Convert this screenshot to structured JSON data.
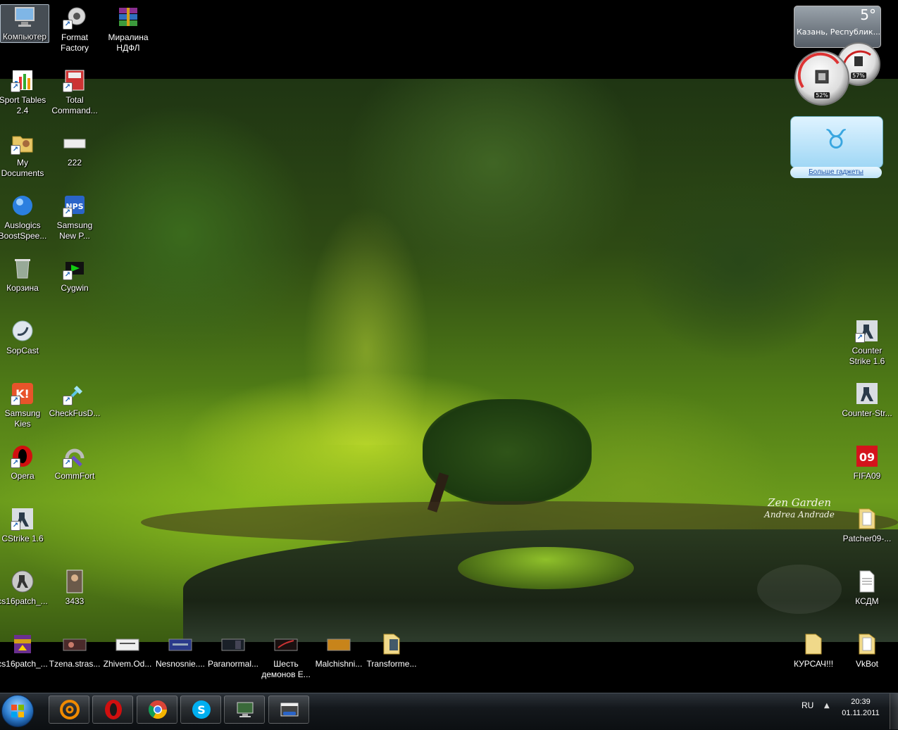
{
  "wallpaper": {
    "title": "Zen Garden",
    "author": "Andrea Andrade"
  },
  "desktop_icons": [
    {
      "id": "computer",
      "label": "Компьютер",
      "icon": "computer-icon"
    },
    {
      "id": "format-factory",
      "label": "Format Factory",
      "icon": "format-factory-icon"
    },
    {
      "id": "miralina",
      "label": "Миралина НДФЛ",
      "icon": "winrar-archive-icon"
    },
    {
      "id": "sport-tables",
      "label": "Sport Tables 2.4",
      "icon": "sport-tables-icon"
    },
    {
      "id": "total-commander",
      "label": "Total Command...",
      "icon": "total-commander-icon"
    },
    {
      "id": "my-documents",
      "label": "My Documents",
      "icon": "documents-folder-icon"
    },
    {
      "id": "file-222",
      "label": "222",
      "icon": "image-file-icon"
    },
    {
      "id": "auslogics",
      "label": "Auslogics BoostSpee...",
      "icon": "auslogics-icon"
    },
    {
      "id": "samsung-nps",
      "label": "Samsung New P...",
      "icon": "nps-icon"
    },
    {
      "id": "recycle-bin",
      "label": "Корзина",
      "icon": "recycle-bin-icon"
    },
    {
      "id": "cygwin",
      "label": "Cygwin",
      "icon": "cygwin-icon"
    },
    {
      "id": "sopcast",
      "label": "SopCast",
      "icon": "sopcast-icon"
    },
    {
      "id": "samsung-kies",
      "label": "Samsung Kies",
      "icon": "kies-icon"
    },
    {
      "id": "checkfusd",
      "label": "CheckFusD...",
      "icon": "checkfusd-icon"
    },
    {
      "id": "opera",
      "label": "Opera",
      "icon": "opera-icon"
    },
    {
      "id": "commfort",
      "label": "CommFort",
      "icon": "commfort-icon"
    },
    {
      "id": "cstrike",
      "label": "CStrike 1.6",
      "icon": "counter-strike-icon"
    },
    {
      "id": "cs16patch1",
      "label": "cs16patch_...",
      "icon": "cs-patch-icon"
    },
    {
      "id": "file-3433",
      "label": "3433",
      "icon": "image-file-icon"
    },
    {
      "id": "cs16patch2",
      "label": "cs16patch_...",
      "icon": "installer-icon"
    },
    {
      "id": "tzena",
      "label": "Tzena.stras...",
      "icon": "video-thumb-icon"
    },
    {
      "id": "zhivem",
      "label": "Zhivem.Od...",
      "icon": "video-thumb-icon"
    },
    {
      "id": "nesnosnie",
      "label": "Nesnosnie....",
      "icon": "video-thumb-icon"
    },
    {
      "id": "paranormal",
      "label": "Paranormal...",
      "icon": "video-thumb-icon"
    },
    {
      "id": "shest",
      "label": "Шесть демонов Е...",
      "icon": "video-thumb-icon"
    },
    {
      "id": "malchishni",
      "label": "Malchishni...",
      "icon": "video-thumb-icon"
    },
    {
      "id": "transforme",
      "label": "Transforme...",
      "icon": "folder-icon"
    },
    {
      "id": "counter-strike-16",
      "label": "Counter Strike 1.6",
      "icon": "counter-strike-icon"
    },
    {
      "id": "counter-str",
      "label": "Counter-Str...",
      "icon": "counter-strike-icon"
    },
    {
      "id": "fifa09",
      "label": "FIFA09",
      "icon": "fifa09-icon"
    },
    {
      "id": "patcher09",
      "label": "Patcher09-...",
      "icon": "folder-icon"
    },
    {
      "id": "ksdm",
      "label": "КСДМ",
      "icon": "text-file-icon"
    },
    {
      "id": "kursach",
      "label": "КУРСАЧ!!!",
      "icon": "folder-icon"
    },
    {
      "id": "vkbot",
      "label": "VkBot",
      "icon": "folder-icon"
    }
  ],
  "gadgets": {
    "weather": {
      "temp": "5°",
      "city": "Казань, Республик..."
    },
    "cpu_meter": {
      "cpu": "52%",
      "ram": "57%"
    },
    "more_gadgets": "Больше гаджеты"
  },
  "taskbar": {
    "pinned": [
      {
        "id": "mail-agent",
        "icon": "mail-agent-icon"
      },
      {
        "id": "opera",
        "icon": "opera-icon"
      },
      {
        "id": "chrome",
        "icon": "chrome-icon"
      },
      {
        "id": "skype",
        "icon": "skype-icon"
      },
      {
        "id": "network",
        "icon": "network-computer-icon"
      },
      {
        "id": "video-editor",
        "icon": "video-editor-pro-icon"
      }
    ],
    "lang": "RU",
    "time": "20:39",
    "date": "01.11.2011"
  },
  "colors": {
    "accent": "#2f7fd1",
    "taskbar": "#14181c"
  }
}
